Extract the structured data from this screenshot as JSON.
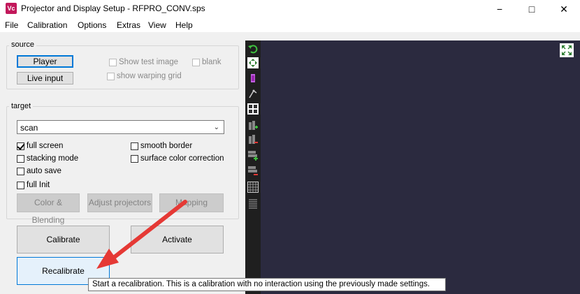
{
  "window": {
    "title": "Projector and Display Setup - RFPRO_CONV.sps",
    "icon_text": "Vc",
    "minimize": "−",
    "maximize": "□",
    "close": "✕"
  },
  "menu": [
    "File",
    "Calibration",
    "Options",
    "Extras",
    "View",
    "Help"
  ],
  "source": {
    "label": "source",
    "player": "Player",
    "live_input": "Live input",
    "show_test_image": "Show test image",
    "blank": "blank",
    "show_warping_grid": "show warping grid"
  },
  "target": {
    "label": "target",
    "selected": "scan",
    "full_screen": "full screen",
    "smooth_border": "smooth border",
    "stacking_mode": "stacking mode",
    "surface_color_correction": "surface color correction",
    "auto_save": "auto save",
    "full_init": "full Init",
    "color_blending": "Color & Blending",
    "adjust_projectors": "Adjust projectors",
    "mapping": "Mapping"
  },
  "actions": {
    "calibrate": "Calibrate",
    "activate": "Activate",
    "recalibrate": "Recalibrate"
  },
  "tooltip": "Start a recalibration. This is a calibration with no interaction using the previously made settings.",
  "colors": {
    "display_bg": "#2b2a3f",
    "toolstrip_bg": "#1f1f1f",
    "annotation_arrow": "#e53935",
    "focus_border": "#0078d7"
  }
}
